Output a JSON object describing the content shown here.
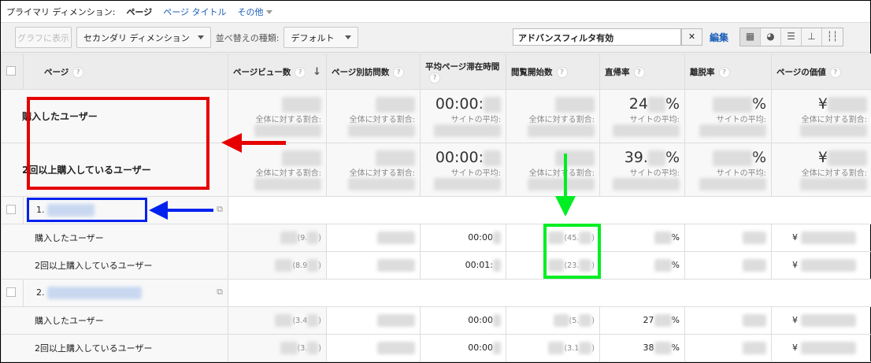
{
  "dimension_bar": {
    "label": "プライマリ ディメンション:",
    "current": "ページ",
    "options": [
      "ページ タイトル",
      "その他"
    ]
  },
  "toolbar": {
    "chart_button": "グラフに表示",
    "secondary_dimension": "セカンダリ ディメンション",
    "sort_label": "並べ替えの種類:",
    "sort_value": "デフォルト",
    "filter_text": "アドバンスフィルタ有効",
    "clear": "✕",
    "edit": "編集",
    "view_icons": [
      "grid-icon",
      "pie-icon",
      "bar-icon",
      "compare-icon",
      "pivot-icon"
    ]
  },
  "columns": [
    "ページ",
    "ページビュー数",
    "ページ別訪問数",
    "平均ページ滞在時間",
    "閲覧開始数",
    "直帰率",
    "離脱率",
    "ページの価値"
  ],
  "sort_arrow": "↓",
  "summary": [
    {
      "name": "購入したユーザー",
      "cells": [
        {
          "v": "",
          "s": "全体に対する割合:"
        },
        {
          "v": "",
          "s": "全体に対する割合:"
        },
        {
          "v": "00:00:",
          "s": "サイトの平均:"
        },
        {
          "v": "",
          "s": "全体に対する割合:"
        },
        {
          "v": "24",
          "suf": "%",
          "s": "サイトの平均:"
        },
        {
          "v": "",
          "suf": "%",
          "s": "サイトの平均:"
        },
        {
          "pre": "¥",
          "v": "",
          "s": "全体に対する割合:"
        }
      ]
    },
    {
      "name": "2回以上購入しているユーザー",
      "cells": [
        {
          "v": "",
          "s": "全体に対する割合:"
        },
        {
          "v": "",
          "s": "全体に対する割合:"
        },
        {
          "v": "00:00:",
          "s": "サイトの平均:"
        },
        {
          "v": "",
          "s": "全体に対する割合:"
        },
        {
          "v": "39.",
          "suf": "%",
          "s": "サイトの平均:"
        },
        {
          "v": "",
          "suf": "%",
          "s": "サイトの平均:"
        },
        {
          "pre": "¥",
          "v": "",
          "s": "全体に対する割合:"
        }
      ]
    }
  ],
  "groups": [
    {
      "index": "1.",
      "rows": [
        {
          "name": "購入したユーザー",
          "pv_pct": "(9.",
          "time": "00:00",
          "ent_pct": "(45.",
          "bounce": "",
          "yen": "¥"
        },
        {
          "name": "2回以上購入しているユーザー",
          "pv_pct": "(8.9",
          "time": "00:01:",
          "ent_pct": "(23.",
          "bounce": "",
          "yen": "¥"
        }
      ]
    },
    {
      "index": "2.",
      "rows": [
        {
          "name": "購入したユーザー",
          "pv_pct": "(3.4",
          "time": "00:00",
          "ent_pct": "(5.",
          "bounce": "27",
          "yen": "¥"
        },
        {
          "name": "2回以上購入しているユーザー",
          "pv_pct": "(3.",
          "time": "00:00",
          "ent_pct": "(3.1",
          "bounce": "38",
          "yen": "¥"
        }
      ]
    }
  ],
  "colors": {
    "red_annotation": "#e60000",
    "blue_annotation": "#0022ee",
    "green_annotation": "#00ee22",
    "link": "#1a5eb8"
  }
}
